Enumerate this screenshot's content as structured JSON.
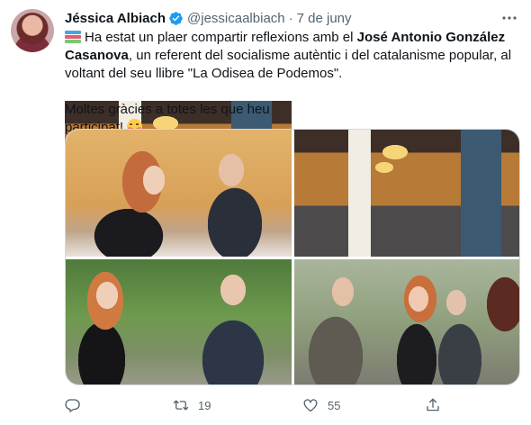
{
  "author": {
    "display_name": "Jéssica Albiach",
    "handle": "@jessicaalbiach",
    "separator": "·",
    "date": "7 de juny",
    "verified": true
  },
  "tweet": {
    "p1_intro": "Ha estat un plaer compartir reflexions amb el ",
    "p1_name": "José Antonio González Casanova",
    "p1_rest": ", un referent del socialisme autèntic i del catalanisme popular, al voltant del seu llibre \"La Odisea de Podemos\".",
    "p2": "Moltes gràcies a totes les que heu participat! ",
    "leading_emoji": "books-emoji",
    "trailing_emoji": "smiling-face-emoji"
  },
  "media": {
    "photo_count": 4
  },
  "actions": {
    "reply_count": "",
    "retweet_count": "19",
    "like_count": "55",
    "share_count": ""
  },
  "colors": {
    "text": "#0f1419",
    "secondary": "#536471",
    "verified": "#1d9bf0",
    "border": "#cfd9de"
  }
}
